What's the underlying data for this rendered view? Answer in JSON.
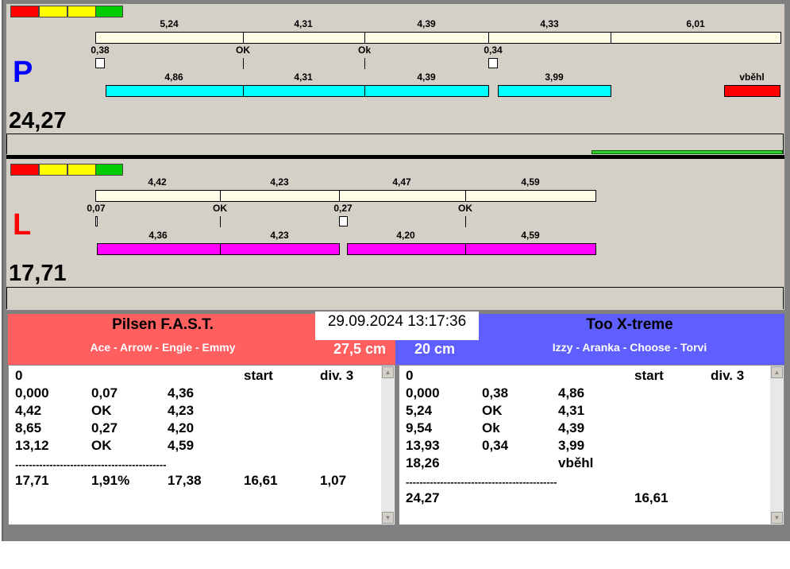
{
  "lanes": {
    "P": {
      "letter": "P",
      "total": "24,27",
      "top_labels": [
        "5,24",
        "4,31",
        "4,39",
        "4,33",
        "6,01"
      ],
      "markers": [
        "0,38",
        "OK",
        "Ok",
        "0,34"
      ],
      "bottom_labels": [
        "4,86",
        "4,31",
        "4,39",
        "3,99",
        "vběhl"
      ]
    },
    "L": {
      "letter": "L",
      "total": "17,71",
      "top_labels": [
        "4,42",
        "4,23",
        "4,47",
        "4,59"
      ],
      "markers": [
        "0,07",
        "OK",
        "0,27",
        "OK"
      ],
      "bottom_labels": [
        "4,36",
        "4,23",
        "4,20",
        "4,59"
      ]
    }
  },
  "datetime": "29.09.2024 13:17:36",
  "left_team": {
    "name": "Pilsen F.A.S.T.",
    "dogs": "Ace - Arrow - Engie - Emmy",
    "height": "27,5 cm",
    "rows": [
      [
        "0",
        "",
        "",
        "start",
        "div. 3"
      ],
      [
        "0,000",
        "0,07",
        "4,36",
        "",
        ""
      ],
      [
        "4,42",
        "OK",
        "4,23",
        "",
        ""
      ],
      [
        "8,65",
        "0,27",
        "4,20",
        "",
        ""
      ],
      [
        "13,12",
        "OK",
        "4,59",
        "",
        ""
      ],
      [
        "--------------------------------------------",
        "",
        "",
        "",
        ""
      ],
      [
        "17,71",
        "1,91%",
        "17,38",
        "16,61",
        "1,07"
      ]
    ]
  },
  "right_team": {
    "name": "Too X-treme",
    "dogs": "Izzy - Aranka - Choose - Torvi",
    "height": "20 cm",
    "rows": [
      [
        "0",
        "",
        "",
        "start",
        "div. 3"
      ],
      [
        "0,000",
        "0,38",
        "4,86",
        "",
        ""
      ],
      [
        "5,24",
        "OK",
        "4,31",
        "",
        ""
      ],
      [
        "9,54",
        "Ok",
        "4,39",
        "",
        ""
      ],
      [
        "13,93",
        "0,34",
        "3,99",
        "",
        ""
      ],
      [
        "18,26",
        "",
        "vběhl",
        "",
        ""
      ],
      [
        "--------------------------------------------",
        "",
        "",
        "",
        ""
      ],
      [
        "24,27",
        "",
        "",
        "16,61",
        ""
      ]
    ]
  },
  "colors": {
    "left": "#ff5f5f",
    "right": "#5f5fff",
    "P": "#0000ff",
    "L": "#ff0000"
  }
}
